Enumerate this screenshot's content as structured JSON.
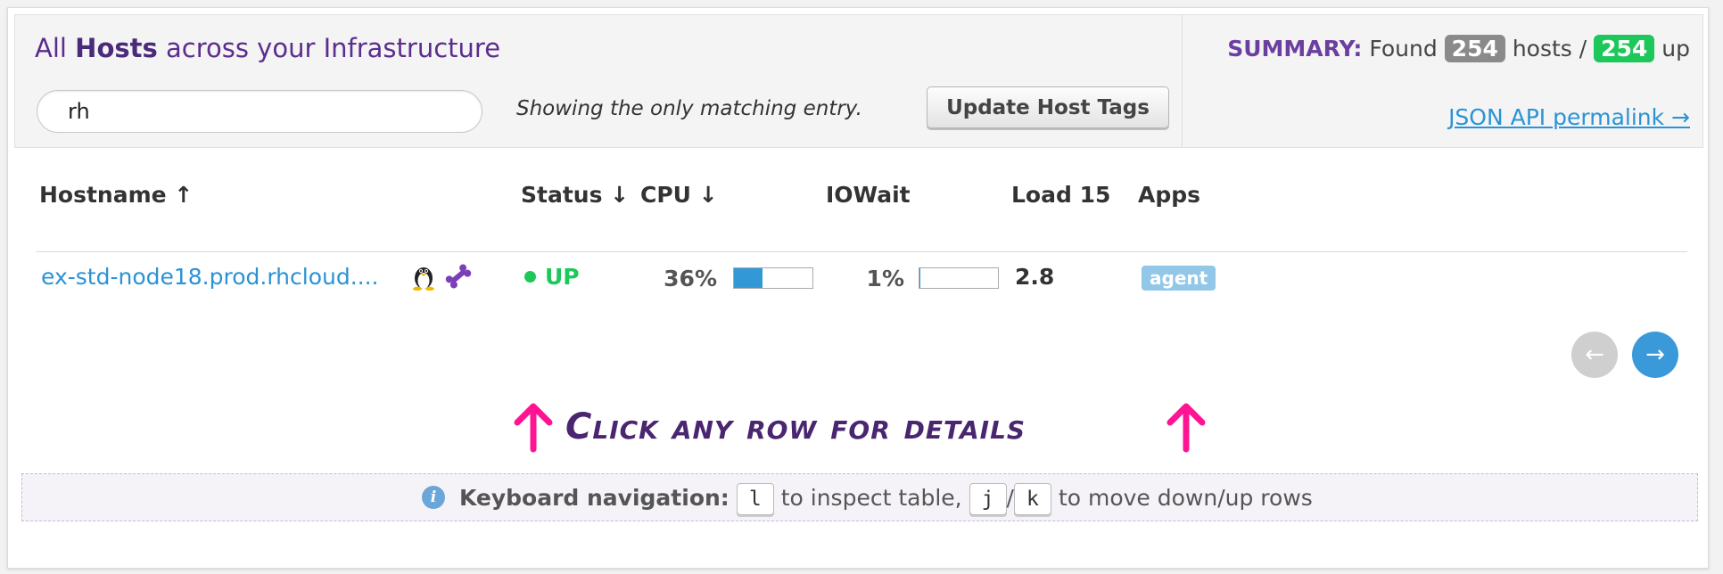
{
  "header": {
    "title_prefix": "All",
    "title_bold": "Hosts",
    "title_suffix": "across your Infrastructure",
    "search_value": "rh",
    "showing_text": "Showing the only matching entry.",
    "update_button": "Update Host Tags"
  },
  "summary": {
    "label": "SUMMARY:",
    "found": "Found",
    "total": "254",
    "hosts_text": "hosts /",
    "up_count": "254",
    "up_text": "up",
    "permalink": "JSON API permalink →"
  },
  "table": {
    "columns": [
      "Hostname ↑",
      "Status ↓",
      "CPU ↓",
      "IOWait",
      "Load 15",
      "Apps"
    ],
    "rows": [
      {
        "hostname": "ex-std-node18.prod.rhcloud....",
        "os_icon": "linux-tux-icon",
        "agent_icon": "bone-icon",
        "status": "UP",
        "cpu_text": "36%",
        "cpu_fraction": 0.36,
        "iowait_text": "1%",
        "iowait_fraction": 0.01,
        "load15": "2.8",
        "apps": [
          "agent"
        ]
      }
    ]
  },
  "pagination": {
    "prev": "←",
    "next": "→"
  },
  "callout": {
    "text": "Click any row for details"
  },
  "keyboard": {
    "label": "Keyboard navigation:",
    "key_inspect": "l",
    "inspect_text": "to inspect table,",
    "key_down": "j",
    "sep": "/",
    "key_up": "k",
    "move_text": "to move down/up rows"
  },
  "colors": {
    "brand_purple": "#5b2d8e",
    "link_blue": "#2a93d5",
    "up_green": "#1cc85a",
    "bar_fill": "#3399d6",
    "arrow_pink": "#ff1493"
  }
}
